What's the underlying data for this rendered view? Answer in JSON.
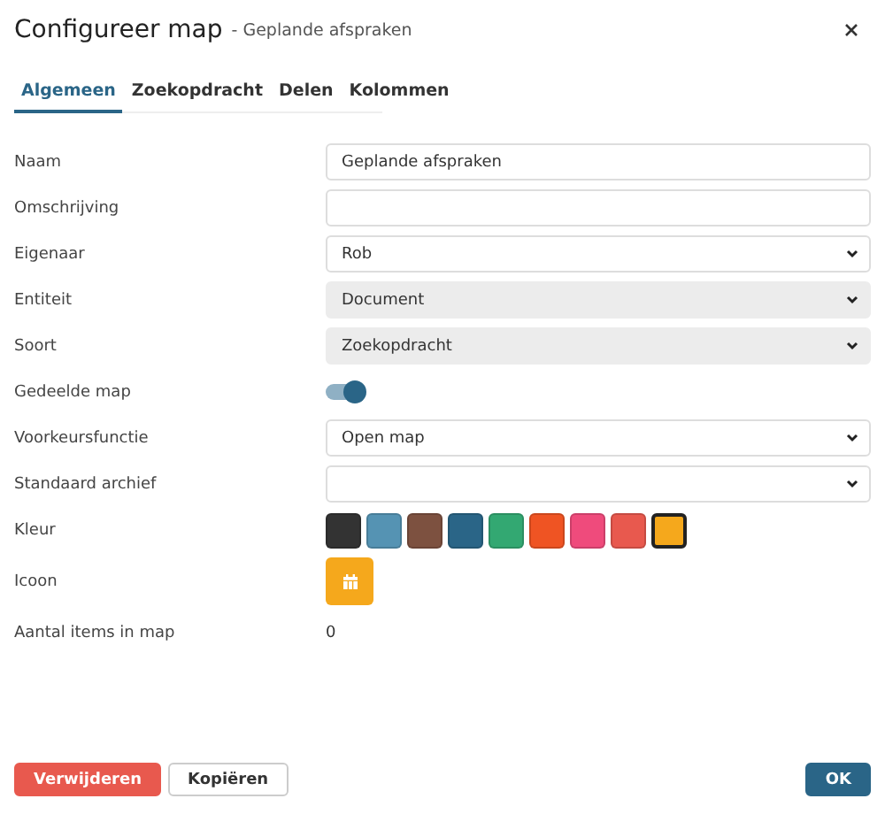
{
  "dialog": {
    "title": "Configureer map",
    "subtitle": "- Geplande afspraken"
  },
  "tabs": [
    {
      "label": "Algemeen",
      "selected": true
    },
    {
      "label": "Zoekopdracht",
      "selected": false
    },
    {
      "label": "Delen",
      "selected": false
    },
    {
      "label": "Kolommen",
      "selected": false
    }
  ],
  "fields": [
    {
      "kind": "text",
      "label": "Naam",
      "value": "Geplande afspraken"
    },
    {
      "kind": "text",
      "label": "Omschrijving"
    },
    {
      "kind": "select",
      "label": "Eigenaar",
      "value": "Rob",
      "disabled": false
    },
    {
      "kind": "select",
      "label": "Entiteit",
      "value": "Document",
      "disabled": true
    },
    {
      "kind": "select",
      "label": "Soort",
      "value": "Zoekopdracht",
      "disabled": true
    },
    {
      "kind": "toggle",
      "label": "Gedeelde map",
      "on": true
    },
    {
      "kind": "select",
      "label": "Voorkeursfunctie",
      "value": "Open map",
      "disabled": false
    },
    {
      "kind": "select",
      "label": "Standaard archief",
      "disabled": false
    },
    {
      "kind": "colors",
      "label": "Kleur",
      "swatches": [
        {
          "color": "#333333",
          "selected": false
        },
        {
          "color": "#5593b3",
          "selected": false
        },
        {
          "color": "#7d5140",
          "selected": false
        },
        {
          "color": "#2a6587",
          "selected": false
        },
        {
          "color": "#33a872",
          "selected": false
        },
        {
          "color": "#ef5423",
          "selected": false
        },
        {
          "color": "#ef4b7c",
          "selected": false
        },
        {
          "color": "#e8594e",
          "selected": false
        },
        {
          "color": "#f5a81c",
          "selected": true
        }
      ]
    },
    {
      "kind": "icon",
      "label": "Icoon",
      "color": "#f5a81c"
    },
    {
      "kind": "value",
      "label": "Aantal items in map",
      "value": "0"
    }
  ],
  "buttons": [
    {
      "label": "Verwijderen",
      "kind": "danger"
    },
    {
      "label": "Kopiëren",
      "kind": "plain"
    },
    {
      "label": "OK",
      "kind": "primary"
    }
  ]
}
